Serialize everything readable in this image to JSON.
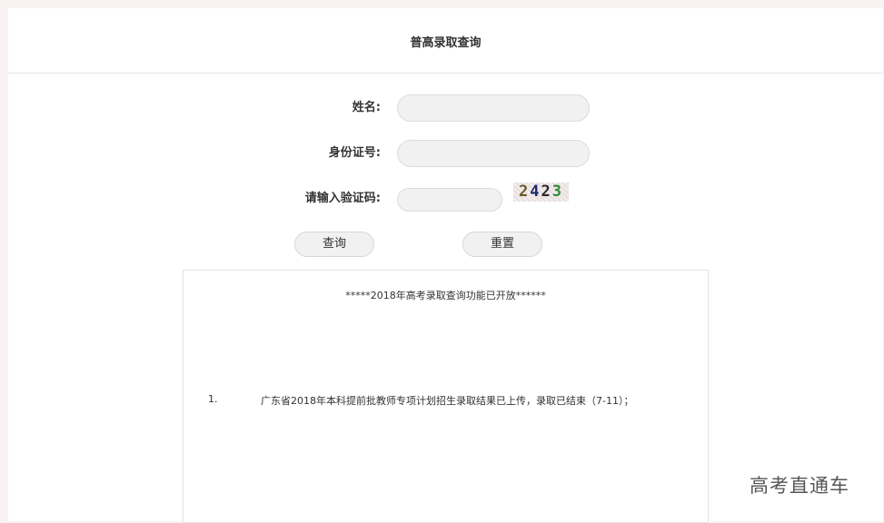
{
  "header": {
    "title": "普高录取查询"
  },
  "form": {
    "name_label": "姓名:",
    "name_value": "",
    "id_label": "身份证号:",
    "id_value": "",
    "captcha_label": "请输入验证码:",
    "captcha_value": "",
    "captcha_digits": [
      {
        "char": "2",
        "color": "#6b5a2a"
      },
      {
        "char": "4",
        "color": "#1e2a6e"
      },
      {
        "char": "2",
        "color": "#2a2a2a"
      },
      {
        "char": "3",
        "color": "#2f8a3a"
      }
    ]
  },
  "buttons": {
    "query_label": "查询",
    "reset_label": "重置"
  },
  "notice": {
    "heading": "*****2018年高考录取查询功能已开放******",
    "items": [
      {
        "num": "1.",
        "text": "广东省2018年本科提前批教师专项计划招生录取结果已上传，录取已结束（7-11）；"
      }
    ]
  },
  "watermark": "高考直通车"
}
